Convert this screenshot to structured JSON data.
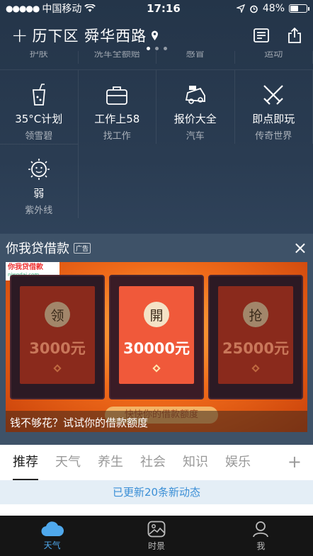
{
  "status_bar": {
    "carrier": "中国移动",
    "time": "17:16",
    "battery": "48%",
    "battery_level": 0.48
  },
  "header": {
    "add_symbol": "+",
    "location": "历下区 舜华西路",
    "page_count": 3,
    "active_page": 1
  },
  "grid_partial": [
    "护肤",
    "洗车全额赔",
    "感冒",
    "运动"
  ],
  "grid": [
    {
      "title": "35°C计划",
      "sub": "领雪碧",
      "icon": "drink-icon"
    },
    {
      "title": "工作上58",
      "sub": "找工作",
      "icon": "briefcase-icon"
    },
    {
      "title": "报价大全",
      "sub": "汽车",
      "icon": "car-icon"
    },
    {
      "title": "即点即玩",
      "sub": "传奇世界",
      "icon": "swords-icon"
    },
    {
      "title": "弱",
      "sub": "紫外线",
      "icon": "sun-icon"
    }
  ],
  "ad": {
    "title": "你我贷借款",
    "tag": "广告",
    "close": "×",
    "logo_text": "你我贷借款",
    "logo_domain": "niwodai.com",
    "envelopes": [
      {
        "char": "领",
        "amount": "3000元"
      },
      {
        "char": "開",
        "amount": "30000元"
      },
      {
        "char": "抢",
        "amount": "25000元"
      }
    ],
    "button_text": "快快你的借款额度",
    "caption": "钱不够花？试试你的借款额度"
  },
  "tabs": {
    "items": [
      "推荐",
      "天气",
      "养生",
      "社会",
      "知识",
      "娱乐"
    ],
    "active": 0,
    "add": "+"
  },
  "notice": "已更新20条新动态",
  "bottom_nav": [
    {
      "label": "天气",
      "icon": "weather-cloud-icon"
    },
    {
      "label": "时景",
      "icon": "photo-icon"
    },
    {
      "label": "我",
      "icon": "user-icon"
    }
  ],
  "colors": {
    "accent": "#4fa8ec",
    "header_bg": "#243549",
    "banner": "#f06b1a"
  }
}
